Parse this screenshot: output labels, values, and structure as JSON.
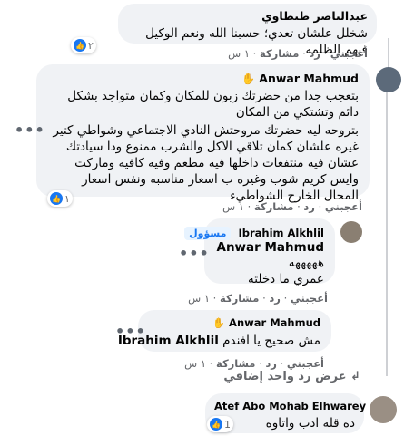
{
  "comments": [
    {
      "author": "عبدالناصر طنطاوي",
      "text": "شخلل علشان تعدي؛ حسبنا الله ونعم الوكيل فيهم الظلمه",
      "reaction_count": "٢",
      "actions": {
        "like": "أعجبني",
        "reply": "رد",
        "share": "مشاركة",
        "time": "١ س"
      }
    },
    {
      "author": "Anwar Mahmud",
      "text_lines": [
        "بتعجب جدا من حضرتك زبون للمكان وكمان متواجد بشكل دائم وتشتكي من المكان",
        "بتروحه ليه حضرتك مروحتش النادي الاجتماعي وشواطي كتير غيره علشان كمان تلاقي الاكل والشرب ممنوع ودا سيادتك عشان فيه منتفعات داخلها فيه مطعم وفيه كافيه وماركت وايس كريم شوب وغيره ب اسعار مناسبه ونفس اسعار المحال الخارج الشواطيء"
      ],
      "reaction_count": "١",
      "actions": {
        "like": "أعجبني",
        "reply": "رد",
        "share": "مشاركة",
        "time": "١ س"
      }
    },
    {
      "author": "Ibrahim Alkhlil",
      "badge": "مسؤول",
      "mention": "Anwar Mahmud",
      "text_lines": [
        "هههههه",
        "عمري ما دخلته"
      ],
      "actions": {
        "like": "أعجبني",
        "reply": "رد",
        "share": "مشاركة",
        "time": "١ س"
      }
    },
    {
      "author": "Anwar Mahmud",
      "mention": "Ibrahim Alkhlil",
      "text": "مش صحيح يا افندم",
      "actions": {
        "like": "أعجبني",
        "reply": "رد",
        "share": "مشاركة",
        "time": "١ س"
      }
    },
    {
      "author": "Atef Abo Mohab Elhwarey",
      "text": "ده قله ادب واتاوه",
      "reaction_count": "1"
    }
  ],
  "more_replies": "عرض رد واحد إضافي",
  "sep": "·",
  "icons": {
    "like": "like-icon",
    "more": "more-options-icon",
    "reply_arrow": "reply-arrow-icon"
  },
  "colors": {
    "bubble": "#f0f2f5",
    "like_blue": "#1877f2",
    "muted": "#65676b"
  }
}
